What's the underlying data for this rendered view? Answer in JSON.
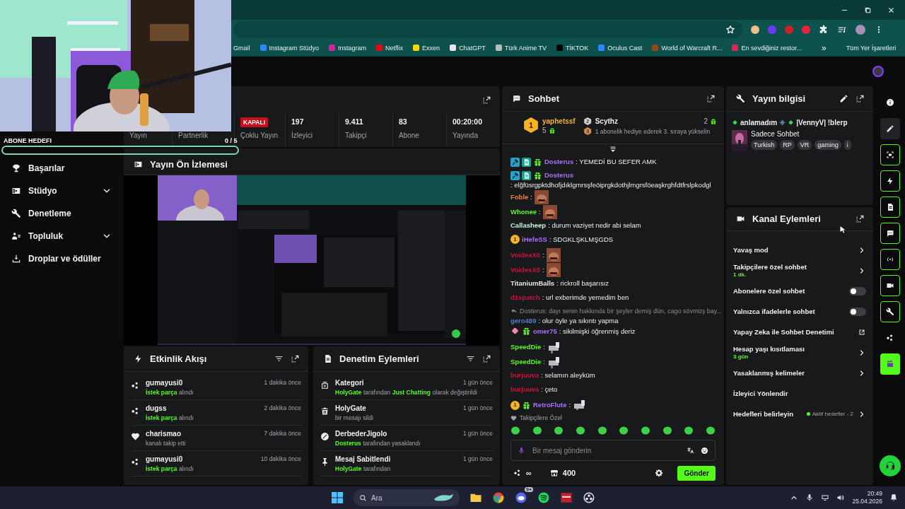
{
  "browser": {
    "bookmarks": [
      {
        "label": "Gmail"
      },
      {
        "label": "Instagram Stüdyo",
        "color": "#2d88ff"
      },
      {
        "label": "Instagram",
        "color": "#d6249f"
      },
      {
        "label": "Netflix",
        "color": "#e50914"
      },
      {
        "label": "Exxen",
        "color": "#f5d90a"
      },
      {
        "label": "ChatGPT",
        "color": "#e8e8e8"
      },
      {
        "label": "Türk Anime TV",
        "color": "#bbbbbb"
      },
      {
        "label": "TİKTOK",
        "color": "#000000"
      },
      {
        "label": "Oculus Cast",
        "color": "#2d88ff"
      },
      {
        "label": "World of Warcraft R...",
        "color": "#8b4a1a"
      },
      {
        "label": "En sevdiğiniz restor...",
        "color": "#e0245e"
      }
    ],
    "more": "»",
    "all_bookmarks": "Tüm Yer İşaretleri"
  },
  "overlay": {
    "goal_label": "ABONE HEDEFI",
    "goal_count": "0 / 5",
    "level": 0
  },
  "sidebar": {
    "items": [
      {
        "label": "Başarılar",
        "expandable": false
      },
      {
        "label": "Stüdyo",
        "expandable": true
      },
      {
        "label": "Denetleme",
        "expandable": false
      },
      {
        "label": "Topluluk",
        "expandable": true
      },
      {
        "label": "Droplar ve ödüller",
        "expandable": false
      }
    ]
  },
  "stats": {
    "items": [
      {
        "label": "Yayın"
      },
      {
        "label": "Partnerlik"
      },
      {
        "badge": "KAPALI",
        "label": "Çoklu Yayın"
      },
      {
        "value": "197",
        "label": "İzleyici"
      },
      {
        "value": "9.411",
        "label": "Takipçi"
      },
      {
        "value": "83",
        "label": "Abone"
      },
      {
        "value": "00:20:00",
        "label": "Yayında"
      }
    ]
  },
  "preview": {
    "title": "Yayın Ön İzlemesi"
  },
  "event_feed": {
    "title": "Etkinlik Akışı",
    "items": [
      {
        "kind": "reward",
        "user": "gumayusi0",
        "detail": [
          {
            "text": "İstek parça",
            "highlight": true
          },
          {
            "text": "alındı",
            "highlight": false
          }
        ],
        "time": "1 dakika önce"
      },
      {
        "kind": "reward",
        "user": "dugss",
        "detail": [
          {
            "text": "İstek parça",
            "highlight": true
          },
          {
            "text": "alındı",
            "highlight": false
          }
        ],
        "time": "2 dakika önce"
      },
      {
        "kind": "follow",
        "user": "charismao",
        "detail": [
          {
            "text": "kanalı takip etti",
            "highlight": false
          }
        ],
        "time": "7 dakika önce"
      },
      {
        "kind": "reward",
        "user": "gumayusi0",
        "detail": [
          {
            "text": "İstek parça",
            "highlight": true
          },
          {
            "text": "alındı",
            "highlight": false
          }
        ],
        "time": "10 dakika önce"
      }
    ]
  },
  "mod_actions": {
    "title": "Denetim Eylemleri",
    "items": [
      {
        "kind": "category",
        "title": "Kategori",
        "detail": [
          {
            "text": "HolyGate",
            "highlight": true
          },
          {
            "text": "tarafından",
            "highlight": false
          },
          {
            "text": "Just Chatting",
            "highlight": true
          },
          {
            "text": "olarak değiştirildi",
            "highlight": false
          }
        ],
        "time": "1 gün önce"
      },
      {
        "kind": "delete",
        "title": "HolyGate",
        "detail": [
          {
            "text": "bir mesajı sildi",
            "highlight": false
          }
        ],
        "time": "1 gün önce"
      },
      {
        "kind": "ban",
        "title": "DerbederJigolo",
        "detail": [
          {
            "text": "Dosterus",
            "highlight": true
          },
          {
            "text": "tarafından yasaklandı",
            "highlight": false
          }
        ],
        "time": "1 gün önce"
      },
      {
        "kind": "pin",
        "title": "Mesaj Sabitlendi",
        "detail": [
          {
            "text": "HolyGate",
            "highlight": true
          },
          {
            "text": "tarafından",
            "highlight": false
          }
        ],
        "time": "1 gün önce"
      }
    ]
  },
  "chat": {
    "title": "Sohbet",
    "leaders": [
      {
        "rank": "1",
        "user": "yaphetssf",
        "count": "5",
        "color": "#f5b325"
      },
      {
        "rank": "2",
        "user": "Scythz",
        "count": "2",
        "color": "#cfd2d6"
      }
    ],
    "next_rank": {
      "rank": "3",
      "text": "1 abonelik hediye ederek 3. sıraya yükselin",
      "color": "#d98c4a"
    },
    "messages": [
      {
        "kind": "text",
        "badges": [
          {
            "kind": "mod"
          },
          {
            "kind": "og"
          },
          {
            "kind": "gift"
          }
        ],
        "user": "Dosterus",
        "color": "#a970ff",
        "text": ": YEMEDİ BU SEFER AMK"
      },
      {
        "kind": "text",
        "badges": [
          {
            "kind": "mod"
          },
          {
            "kind": "og"
          },
          {
            "kind": "gift"
          }
        ],
        "user": "Dosterus",
        "color": "#a970ff",
        "text": ": elğfüsrgpktdhofjdıklgmrsşfeöiprgkdothjlmgrsföeaşkrghfdtfrslpkodgl"
      },
      {
        "user": "Foble",
        "color": "#e8823a",
        "text": ":"
      },
      {
        "user": "Whonee",
        "color": "#53fc18",
        "text": ":"
      },
      {
        "kind": "text",
        "user": "Callasheep",
        "color": "#c9f2d6",
        "text": ": durum vaziyet nedir abi selam"
      },
      {
        "kind": "text",
        "badges": [
          {
            "kind": "rank",
            "label": "1"
          }
        ],
        "user": "iHefeSS",
        "color": "#a970ff",
        "text": ": SDGKLŞKLMŞGDS"
      },
      {
        "user": "VoidexX0",
        "color": "#c4163f",
        "text": ":"
      },
      {
        "user": "VoidexX0",
        "color": "#c4163f",
        "text": ":"
      },
      {
        "kind": "text",
        "user": "TitaniumBalls",
        "color": "#e6e6e6",
        "text": ": rickroll başarısız"
      },
      {
        "kind": "text",
        "user": "d1spatch",
        "color": "#c4163f",
        "text": ": url exberimde yemedim ben"
      },
      {
        "kind": "text",
        "reply": "Dosterus: dayı senin hakkında bir şeyler demiş dün, cago sövmüş bay...",
        "user": "gero489",
        "color": "#4d7fbf",
        "text": ": olur öyle ya sıkıntı yapma"
      },
      {
        "kind": "text",
        "badges": [
          {
            "kind": "clover"
          },
          {
            "kind": "gift"
          }
        ],
        "user": "omer75",
        "color": "#a970ff",
        "text": ": sikilmişki öğrenmiş deriz"
      },
      {
        "kind": "sticker",
        "user": "SpeedDie",
        "color": "#53fc18",
        "text": ":"
      },
      {
        "kind": "sticker",
        "user": "SpeedDie",
        "color": "#53fc18",
        "text": ":"
      },
      {
        "kind": "text",
        "user": "burjuuva",
        "color": "#c4163f",
        "text": ": selamın aleyküm"
      },
      {
        "kind": "text",
        "user": "burjuuva",
        "color": "#c4163f",
        "text": ": çeto"
      },
      {
        "kind": "sticker",
        "badges": [
          {
            "kind": "rank",
            "label": "1"
          },
          {
            "kind": "gift"
          }
        ],
        "user": "RetroFlute",
        "color": "#a970ff",
        "text": ":"
      }
    ],
    "emote_section": "Takipçilere Özel",
    "input": {
      "placeholder": "Bir mesaj gönderin"
    },
    "points": "∞",
    "shop_count": "400",
    "send": "Gönder"
  },
  "stream_info": {
    "title": "Yayın bilgisi",
    "title_parts": [
      "anlamadım",
      "|VennyV| !blerp"
    ],
    "category": "Sadece Sohbet",
    "tags": [
      "Turkish",
      "RP",
      "VR",
      "gaming",
      "i"
    ]
  },
  "channel_actions": {
    "title": "Kanal Eylemleri",
    "items": [
      {
        "kind": "chevron",
        "label": "Yavaş mod"
      },
      {
        "kind": "chevron",
        "label": "Takipçilere özel sohbet",
        "sub": "1 dk."
      },
      {
        "kind": "toggle",
        "label": "Abonelere özel sohbet",
        "on": false
      },
      {
        "kind": "toggle",
        "label": "Yalnızca ifadelerle sohbet",
        "on": false
      },
      {
        "kind": "external",
        "label": "Yapay Zeka ile Sohbet Denetimi"
      },
      {
        "kind": "chevron",
        "label": "Hesap yaşı kısıtlaması",
        "sub": "3 gün"
      },
      {
        "kind": "chevron",
        "label": "Yasaklanmış kelimeler"
      },
      {
        "kind": "plain",
        "label": "İzleyici Yönlendir"
      },
      {
        "kind": "goal",
        "label": "Hedefleri belirleyin",
        "status": "Aktif hedefler - 2"
      }
    ]
  },
  "rail": {
    "items": [
      {
        "kind": "plain"
      },
      {
        "kind": "shaded"
      },
      {
        "kind": "outlined"
      },
      {
        "kind": "outlined"
      },
      {
        "kind": "outlined"
      },
      {
        "kind": "outlined"
      },
      {
        "kind": "outlined"
      },
      {
        "kind": "outlined"
      },
      {
        "kind": "outlined"
      },
      {
        "kind": "plain"
      },
      {
        "kind": "filled"
      }
    ]
  },
  "taskbar": {
    "search": "Ara",
    "discord_badge": "9+",
    "time": "20:49",
    "date": "25.04.2026"
  }
}
